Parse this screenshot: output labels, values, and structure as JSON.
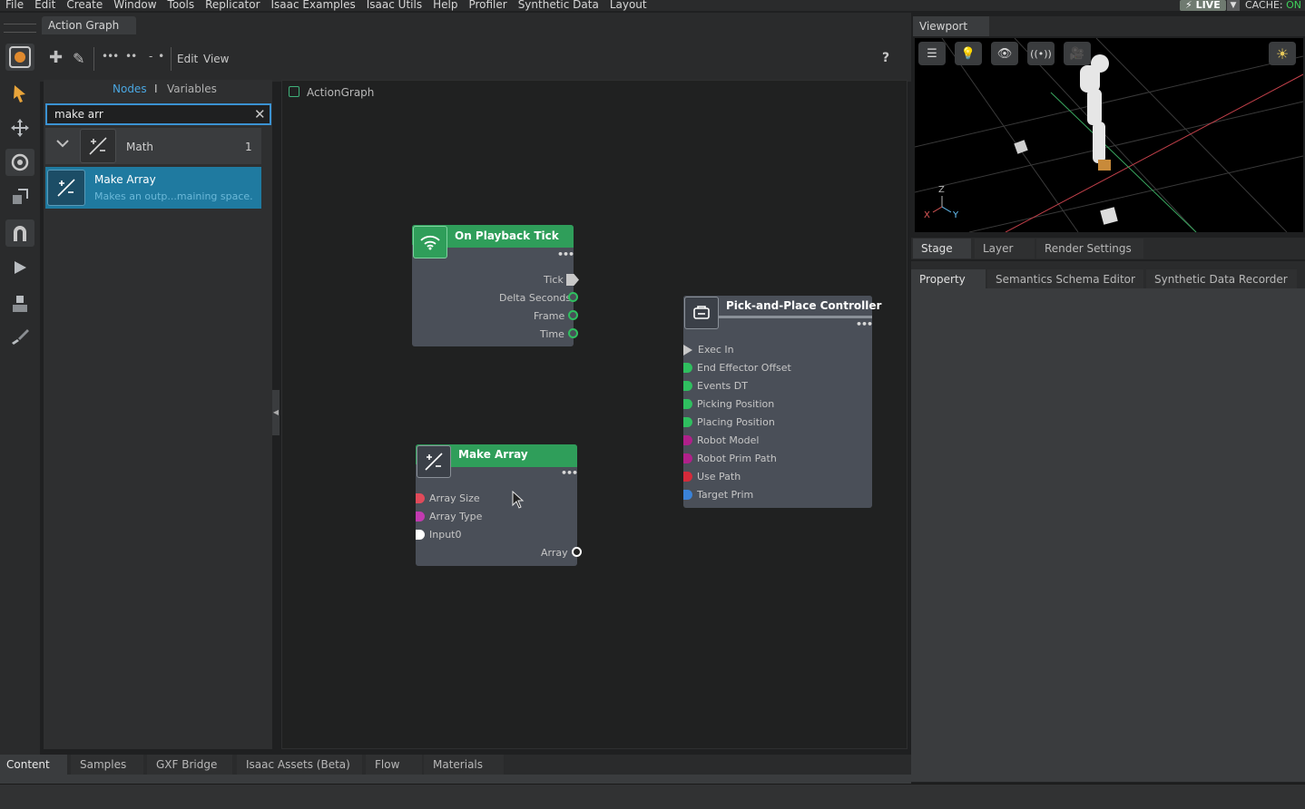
{
  "menubar": {
    "items": [
      "File",
      "Edit",
      "Create",
      "Window",
      "Tools",
      "Replicator",
      "Isaac Examples",
      "Isaac Utils",
      "Help",
      "Profiler",
      "Synthetic Data",
      "Layout"
    ],
    "live_label": "LIVE",
    "cache_label": "CACHE:",
    "cache_state": "ON"
  },
  "left_toolbar": {
    "icons": [
      "omniverse-logo-icon",
      "select-arrow-icon",
      "move-icon",
      "rotate-icon",
      "scale-icon",
      "snap-magnet-icon",
      "play-icon",
      "physics-icon",
      "paint-brush-icon"
    ]
  },
  "action_graph": {
    "tab_title": "Action Graph",
    "toolbar": {
      "edit_label": "Edit",
      "view_label": "View",
      "help_label": "?"
    },
    "library": {
      "nodes_tab": "Nodes",
      "separator": "I",
      "variables_tab": "Variables",
      "search_value": "make arr",
      "category": {
        "label": "Math",
        "count": "1"
      },
      "result": {
        "name": "Make Array",
        "description": "Makes an outp...maining space."
      }
    },
    "breadcrumb": "ActionGraph",
    "nodes": {
      "on_playback_tick": {
        "title": "On Playback Tick",
        "outputs": [
          "Tick",
          "Delta Seconds",
          "Frame",
          "Time"
        ]
      },
      "make_array": {
        "title": "Make Array",
        "inputs": [
          "Array Size",
          "Array Type",
          "Input0"
        ],
        "output": "Array"
      },
      "pick_place": {
        "title": "Pick-and-Place Controller",
        "inputs": [
          "Exec In",
          "End Effector Offset",
          "Events DT",
          "Picking Position",
          "Placing Position",
          "Robot Model",
          "Robot Prim Path",
          "Use Path",
          "Target Prim"
        ]
      }
    }
  },
  "viewport": {
    "tab_title": "Viewport",
    "axis_labels": {
      "x": "X",
      "y": "Y",
      "z": "Z"
    }
  },
  "stage_tabs": [
    "Stage",
    "Layer",
    "Render Settings"
  ],
  "property_tabs": [
    "Property",
    "Semantics Schema Editor",
    "Synthetic Data Recorder"
  ],
  "bottom_tabs": [
    "Content",
    "Samples",
    "GXF Bridge",
    "Isaac Assets (Beta)",
    "Flow",
    "Materials"
  ],
  "colors": {
    "accent_blue": "#3b92d2",
    "node_header_green": "#2f9e5a",
    "selection_blue": "#1f7aa0",
    "live_green": "#3fcf5a"
  }
}
